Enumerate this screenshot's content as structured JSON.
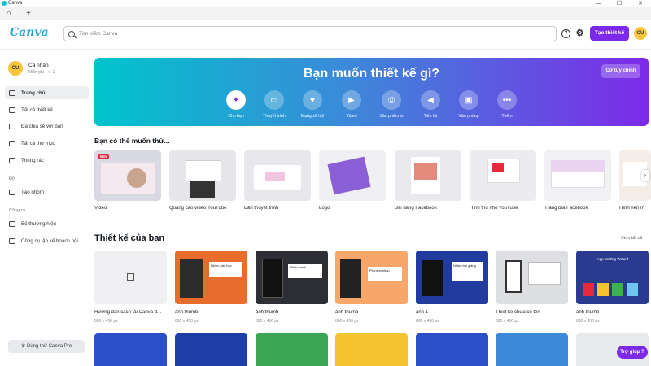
{
  "window": {
    "title": "Canva",
    "minimize": "—",
    "maximize": "☐",
    "close": "✕"
  },
  "tabs": {
    "home_icon": "⌂",
    "add_icon": "+"
  },
  "topbar": {
    "brand": "Canva",
    "search_placeholder": "Tìm kiếm Canva",
    "help_icon": "?",
    "settings_icon": "⚙",
    "design_button": "Tạo thiết kế",
    "avatar": "CU"
  },
  "sidebar": {
    "profile": {
      "avatar": "CU",
      "name": "Cá nhân",
      "sub": "Miễn phí • ⚇ 1"
    },
    "items": [
      {
        "label": "Trang chủ",
        "icon": "home-icon"
      },
      {
        "label": "Tất cả thiết kế",
        "icon": "grid-icon"
      },
      {
        "label": "Đã chia sẻ với bạn",
        "icon": "share-icon"
      },
      {
        "label": "Tất cả thư mục",
        "icon": "folder-icon"
      },
      {
        "label": "Thùng rác",
        "icon": "trash-icon"
      }
    ],
    "section_team": "Đội",
    "team_items": [
      {
        "label": "Tạo nhóm",
        "icon": "team-icon"
      }
    ],
    "section_tools": "Công cụ",
    "tool_items": [
      {
        "label": "Bộ thương hiệu",
        "icon": "brand-icon"
      },
      {
        "label": "Công cụ lập kế hoạch nội ...",
        "icon": "calendar-icon"
      }
    ],
    "try_pro": "♛ Dùng thử Canva Pro"
  },
  "hero": {
    "title": "Bạn muốn thiết kế gì?",
    "custom_button": "Cỡ tùy chỉnh",
    "categories": [
      {
        "label": "Cho bạn",
        "glyph": "✦"
      },
      {
        "label": "Thuyết trình",
        "glyph": "▭"
      },
      {
        "label": "Mạng xã hội",
        "glyph": "♥"
      },
      {
        "label": "Video",
        "glyph": "▶"
      },
      {
        "label": "Sản phẩm in",
        "glyph": "⎙"
      },
      {
        "label": "Tiếp thị",
        "glyph": "◀"
      },
      {
        "label": "Văn phòng",
        "glyph": "▣"
      },
      {
        "label": "Thêm",
        "glyph": "•••"
      }
    ]
  },
  "suggest": {
    "title": "Bạn có thể muốn thử...",
    "badge": "Mới",
    "items": [
      "Video",
      "Quảng cáo video YouTube",
      "Bản thuyết trình",
      "Logo",
      "Bài đăng Facebook",
      "Hình thu nhỏ YouTube",
      "Trang bìa Facebook",
      "Hình nền m"
    ],
    "next": "›"
  },
  "designs": {
    "title": "Thiết kế của bạn",
    "see_all": "Xem tất cả",
    "items": [
      {
        "title": "Hướng dẫn cách tải Canva đ...",
        "size": "800 x 450 px"
      },
      {
        "title": "ảnh thumb",
        "size": "800 x 450 px"
      },
      {
        "title": "ảnh thumb",
        "size": "800 x 450 px"
      },
      {
        "title": "ảnh thumb",
        "size": "800 x 450 px"
      },
      {
        "title": "ảnh 1",
        "size": "800 x 450 px"
      },
      {
        "title": "Thiết kế chưa có tên",
        "size": "800 x 450 px"
      },
      {
        "title": "ảnh thumb",
        "size": "800 x 450 px"
      }
    ],
    "thumb_texts": [
      "Nhiều bậc học",
      "Nhiều cách",
      "Phương pháp",
      "Nhiều bài giảng",
      "App Writing Wizard"
    ]
  },
  "help_button": "Trợ giúp ?",
  "colors": {
    "accent": "#7d2ae8",
    "hero_start": "#00c4cc",
    "hero_end": "#7d2ae8",
    "avatar": "#f6c43d"
  }
}
